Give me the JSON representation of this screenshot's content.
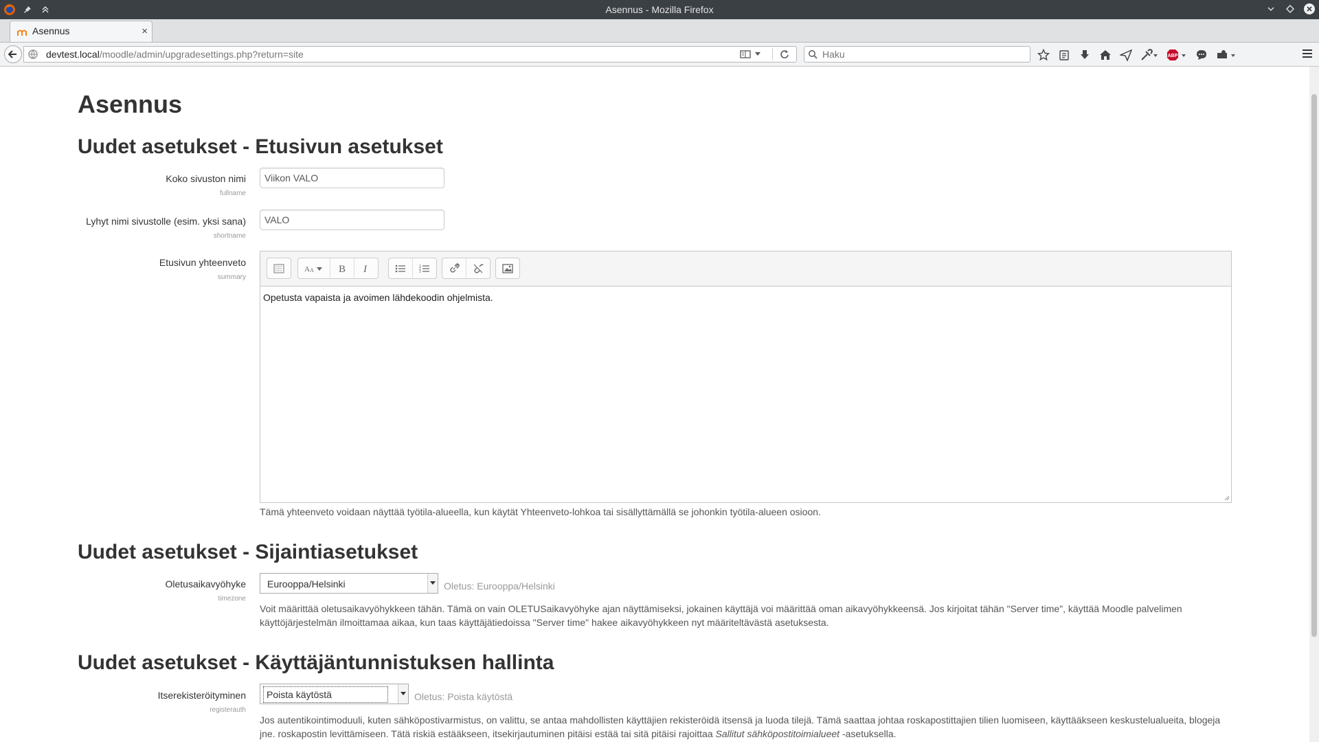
{
  "window": {
    "title": "Asennus - Mozilla Firefox"
  },
  "tab": {
    "label": "Asennus",
    "close": "×",
    "new_tab": "+"
  },
  "navbar": {
    "url_host": "devtest.local",
    "url_path": "/moodle/admin/upgradesettings.php?return=site",
    "search_placeholder": "Haku",
    "toolbar_icons": [
      "bookmark-star-icon",
      "reading-list-icon",
      "download-icon",
      "home-icon",
      "send-icon",
      "eyedropper-icon",
      "adblock-plus-icon",
      "chat-icon",
      "extension-icon",
      "hamburger-menu-icon"
    ]
  },
  "page": {
    "title": "Asennus",
    "section_frontpage": "Uudet asetukset - Etusivun asetukset",
    "section_location": "Uudet asetukset - Sijaintiasetukset",
    "section_auth": "Uudet asetukset - Käyttäjäntunnistuksen hallinta"
  },
  "fullname": {
    "label": "Koko sivuston nimi",
    "machine": "fullname",
    "value": "Viikon VALO"
  },
  "shortname": {
    "label": "Lyhyt nimi sivustolle (esim. yksi sana)",
    "machine": "shortname",
    "value": "VALO"
  },
  "summary": {
    "label": "Etusivun yhteenveto",
    "machine": "summary",
    "content": "Opetusta vapaista ja avoimen lähdekoodin ohjelmista.",
    "description": "Tämä yhteenveto voidaan näyttää työtila-alueella, kun käytät Yhteenveto-lohkoa tai sisällyttämällä se johonkin työtila-alueen osioon."
  },
  "timezone": {
    "label": "Oletusaikavyöhyke",
    "machine": "timezone",
    "value": "Eurooppa/Helsinki",
    "default": "Oletus: Eurooppa/Helsinki",
    "description": "Voit määrittää oletusaikavyöhykkeen tähän. Tämä on vain OLETUSaikavyöhyke ajan näyttämiseksi, jokainen käyttäjä voi määrittää oman aikavyöhykkeensä. Jos kirjoitat tähän \"Server time\", käyttää Moodle palvelimen käyttöjärjestelmän ilmoittamaa aikaa, kun taas käyttäjätiedoissa \"Server time\" hakee aikavyöhykkeen nyt määriteltävästä asetuksesta."
  },
  "registerauth": {
    "label": "Itserekisteröityminen",
    "machine": "registerauth",
    "value": "Poista käytöstä",
    "default": "Oletus: Poista käytöstä",
    "description_before": "Jos autentikointimoduuli, kuten sähköpostivarmistus, on valittu, se antaa mahdollisten käyttäjien rekisteröidä itsensä ja luoda tilejä. Tämä saattaa johtaa roskapostittajien tilien luomiseen, käyttääkseen keskustelualueita, blogeja jne. roskapostin levittämiseen. Tätä riskiä estääkseen, itsekirjautuminen pitäisi estää tai sitä pitäisi rajoittaa",
    "description_em": "Sallitut sähköpostitoimialueet",
    "description_after": "-asetuksella."
  },
  "colors": {
    "titlebar": "#3b4045",
    "text": "#333333",
    "muted": "#999999"
  }
}
